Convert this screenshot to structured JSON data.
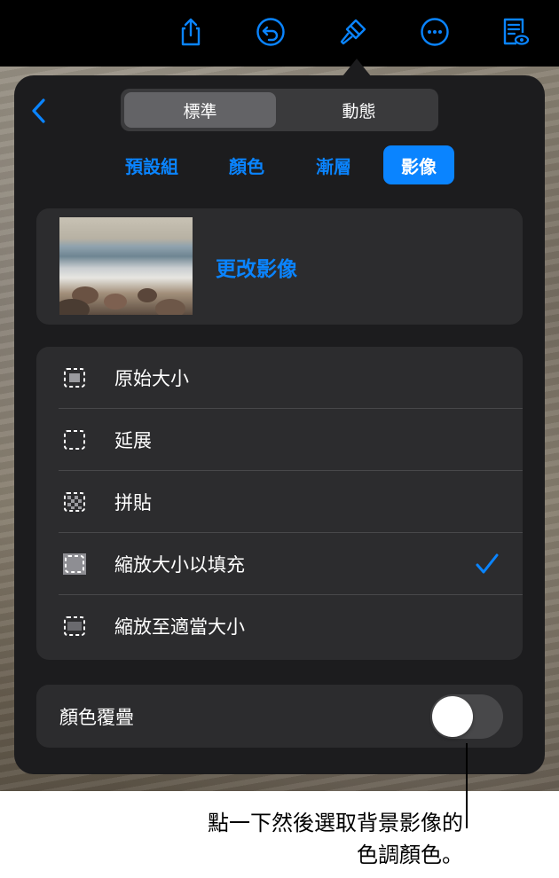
{
  "toolbar": {
    "icons": [
      "share-icon",
      "undo-icon",
      "format-brush-icon",
      "more-icon",
      "reader-view-icon"
    ]
  },
  "popover": {
    "segmented": {
      "standard": "標準",
      "dynamic": "動態"
    },
    "subtabs": {
      "presets": "預設組",
      "color": "顏色",
      "gradient": "漸層",
      "image": "影像"
    },
    "image_card": {
      "change_label": "更改影像"
    },
    "options": [
      {
        "label": "原始大小",
        "checked": false
      },
      {
        "label": "延展",
        "checked": false
      },
      {
        "label": "拼貼",
        "checked": false
      },
      {
        "label": "縮放大小以填充",
        "checked": true
      },
      {
        "label": "縮放至適當大小",
        "checked": false
      }
    ],
    "color_overlay": {
      "label": "顏色覆疊",
      "enabled": false
    }
  },
  "callout": {
    "line1": "點一下然後選取背景影像的",
    "line2": "色調顏色。"
  },
  "colors": {
    "accent": "#0a84ff",
    "panel": "#1c1c1e",
    "card": "#2c2c2e"
  }
}
